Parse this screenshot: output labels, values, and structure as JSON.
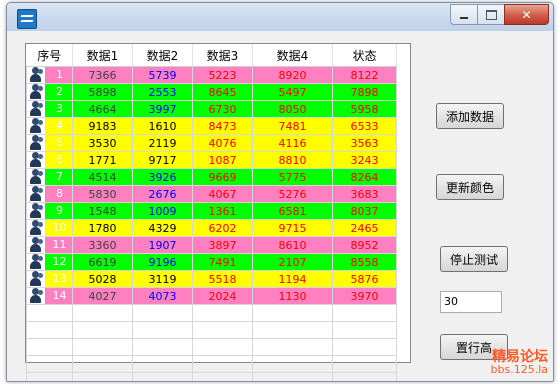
{
  "window": {
    "title": ""
  },
  "buttons": {
    "add_data": "添加数据",
    "update_color": "更新颜色",
    "stop_test": "停止测试",
    "set_row_height": "置行高"
  },
  "count_input": {
    "value": "30"
  },
  "watermark": {
    "line1": "精易论坛",
    "line2": "bbs.125.la"
  },
  "grid": {
    "columns": [
      "序号",
      "数据1",
      "数据2",
      "数据3",
      "数据4",
      "状态"
    ],
    "empty_rows": 5,
    "rows": [
      {
        "index": "1",
        "bg": "#ff80c0",
        "values": [
          "7366",
          "5739",
          "5223",
          "8920",
          "8122"
        ],
        "colors": [
          "#404040",
          "#0000ff",
          "#ff0000",
          "#ff0000",
          "#ff0000"
        ]
      },
      {
        "index": "2",
        "bg": "#00ff00",
        "values": [
          "5898",
          "2553",
          "8645",
          "5497",
          "7898"
        ],
        "colors": [
          "#404040",
          "#0000ff",
          "#ff0000",
          "#ff0000",
          "#ff0000"
        ]
      },
      {
        "index": "3",
        "bg": "#00ff00",
        "values": [
          "4664",
          "3997",
          "6730",
          "8050",
          "5958"
        ],
        "colors": [
          "#404040",
          "#0000ff",
          "#ff0000",
          "#ff0000",
          "#ff0000"
        ]
      },
      {
        "index": "4",
        "bg": "#ffff00",
        "values": [
          "9183",
          "1610",
          "8473",
          "7481",
          "6533"
        ],
        "colors": [
          "#000000",
          "#000000",
          "#ff0000",
          "#ff0000",
          "#ff0000"
        ]
      },
      {
        "index": "5",
        "bg": "#ffff00",
        "values": [
          "3530",
          "2119",
          "4076",
          "4116",
          "3563"
        ],
        "colors": [
          "#000000",
          "#000000",
          "#ff0000",
          "#ff0000",
          "#ff0000"
        ]
      },
      {
        "index": "6",
        "bg": "#ffff00",
        "values": [
          "1771",
          "9717",
          "1087",
          "8810",
          "3243"
        ],
        "colors": [
          "#000000",
          "#000000",
          "#ff0000",
          "#ff0000",
          "#ff0000"
        ]
      },
      {
        "index": "7",
        "bg": "#00ff00",
        "values": [
          "4514",
          "3926",
          "9669",
          "5775",
          "8264"
        ],
        "colors": [
          "#404040",
          "#0000ff",
          "#ff0000",
          "#ff0000",
          "#ff0000"
        ]
      },
      {
        "index": "8",
        "bg": "#ff80c0",
        "values": [
          "5830",
          "2676",
          "4067",
          "5276",
          "3683"
        ],
        "colors": [
          "#404040",
          "#0000ff",
          "#ff0000",
          "#ff0000",
          "#ff0000"
        ]
      },
      {
        "index": "9",
        "bg": "#00ff00",
        "values": [
          "1548",
          "1009",
          "1361",
          "6581",
          "8037"
        ],
        "colors": [
          "#404040",
          "#0000ff",
          "#ff0000",
          "#ff0000",
          "#ff0000"
        ]
      },
      {
        "index": "10",
        "bg": "#ffff00",
        "values": [
          "1780",
          "4329",
          "6202",
          "9715",
          "2465"
        ],
        "colors": [
          "#000000",
          "#000000",
          "#ff0000",
          "#ff0000",
          "#ff0000"
        ]
      },
      {
        "index": "11",
        "bg": "#ff80c0",
        "values": [
          "3360",
          "1907",
          "3897",
          "8610",
          "8952"
        ],
        "colors": [
          "#404040",
          "#0000ff",
          "#ff0000",
          "#ff0000",
          "#ff0000"
        ]
      },
      {
        "index": "12",
        "bg": "#00ff00",
        "values": [
          "6619",
          "9196",
          "7491",
          "2107",
          "8558"
        ],
        "colors": [
          "#404040",
          "#0000ff",
          "#ff0000",
          "#ff0000",
          "#ff0000"
        ]
      },
      {
        "index": "13",
        "bg": "#ffff00",
        "values": [
          "5028",
          "3119",
          "5518",
          "1194",
          "5876"
        ],
        "colors": [
          "#000000",
          "#000000",
          "#ff0000",
          "#ff0000",
          "#ff0000"
        ]
      },
      {
        "index": "14",
        "bg": "#ff80c0",
        "values": [
          "4027",
          "4073",
          "2024",
          "1130",
          "3970"
        ],
        "colors": [
          "#404040",
          "#0000ff",
          "#ff0000",
          "#ff0000",
          "#ff0000"
        ]
      }
    ]
  }
}
